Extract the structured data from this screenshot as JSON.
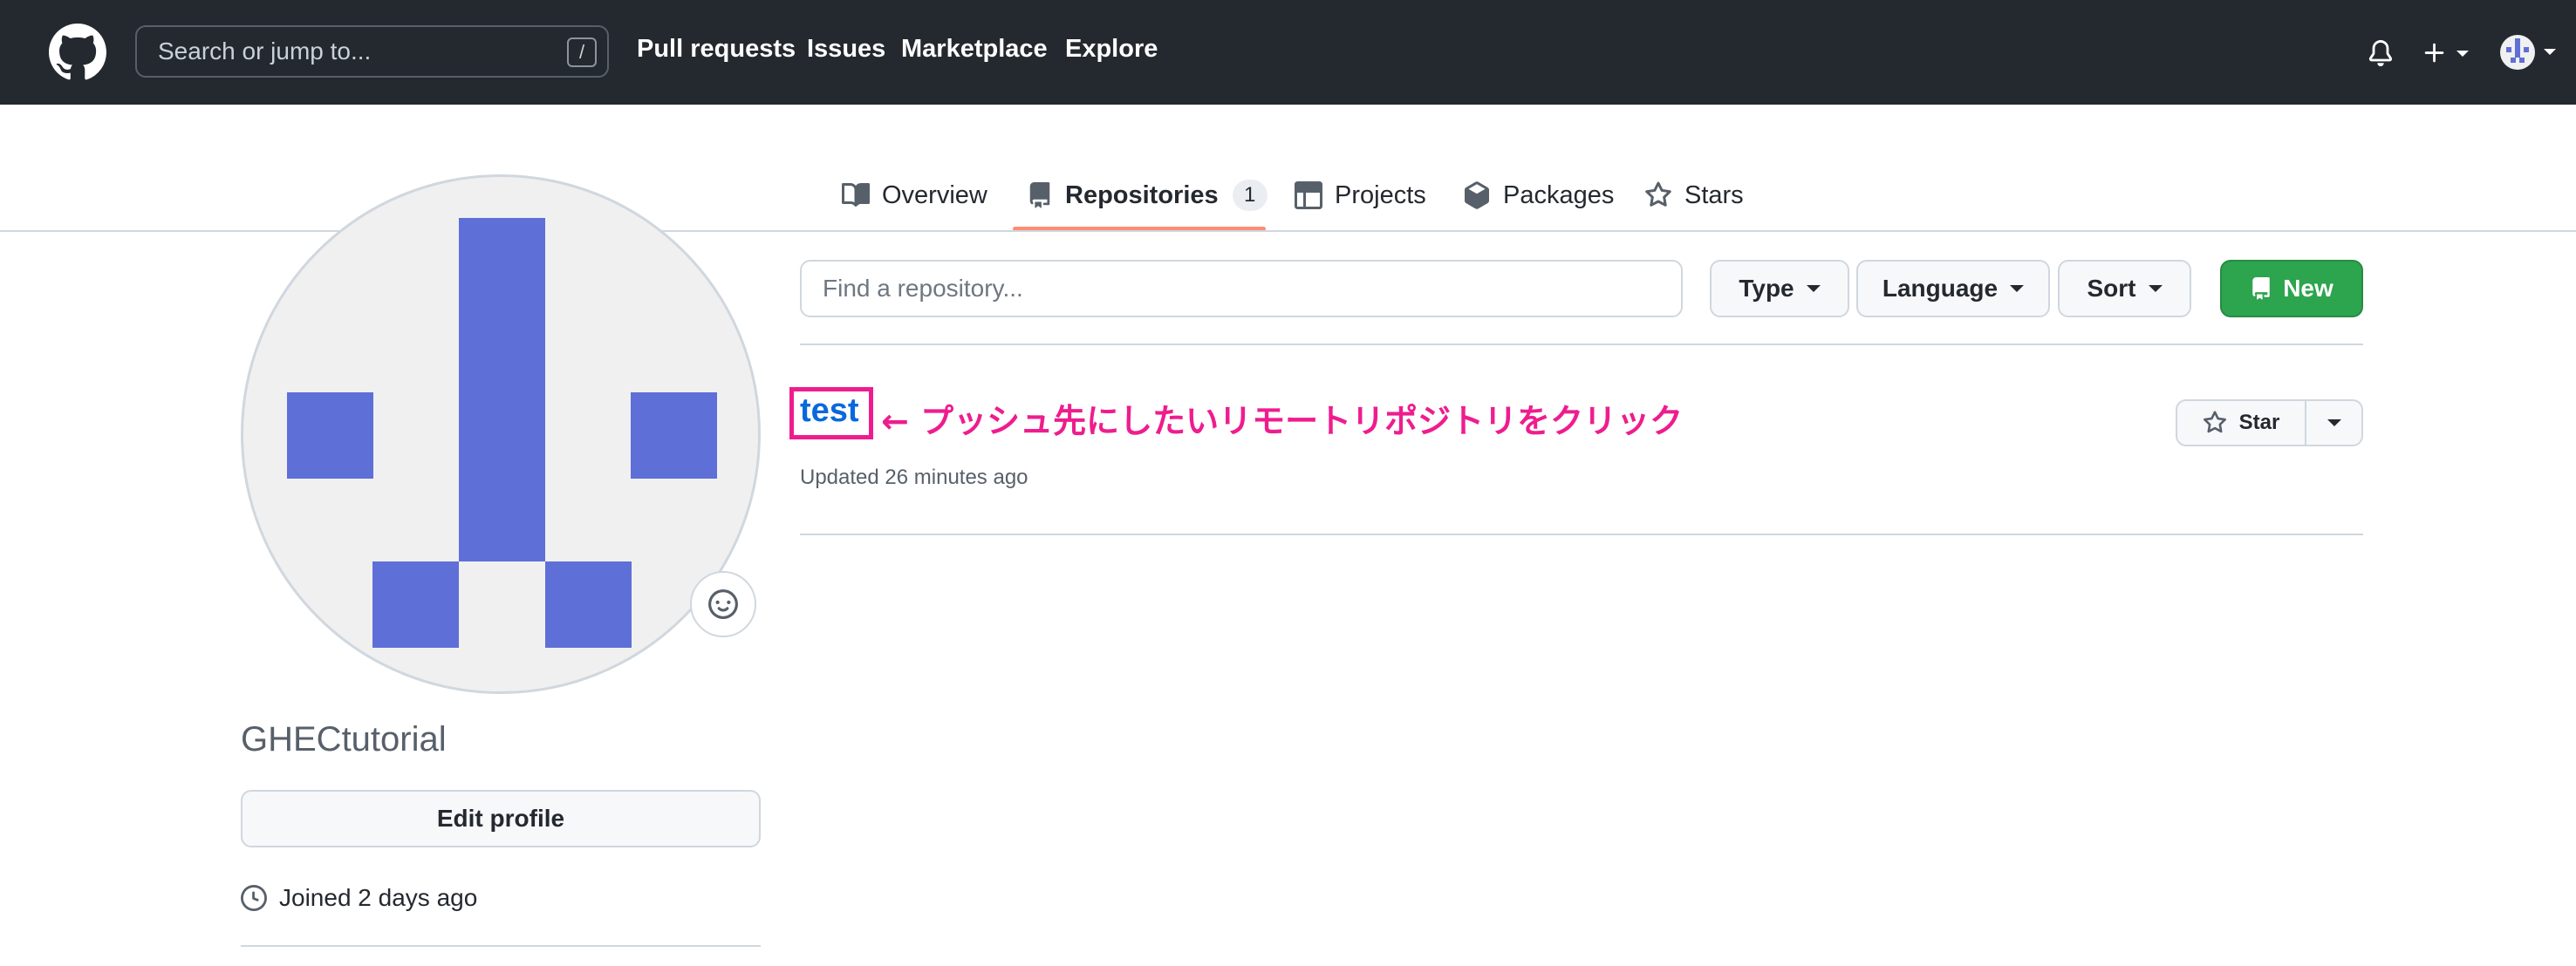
{
  "header": {
    "search_placeholder": "Search or jump to...",
    "search_shortcut": "/",
    "nav": [
      "Pull requests",
      "Issues",
      "Marketplace",
      "Explore"
    ]
  },
  "tabs": [
    {
      "label": "Overview",
      "icon": "book-icon"
    },
    {
      "label": "Repositories",
      "icon": "repo-icon",
      "count": "1",
      "active": true
    },
    {
      "label": "Projects",
      "icon": "table-icon"
    },
    {
      "label": "Packages",
      "icon": "package-icon"
    },
    {
      "label": "Stars",
      "icon": "star-icon"
    }
  ],
  "profile": {
    "username": "GHECtutorial",
    "edit_label": "Edit profile",
    "joined": "Joined 2 days ago",
    "avatar_color": "#5f6fd8"
  },
  "repo_controls": {
    "find_placeholder": "Find a repository...",
    "type_label": "Type",
    "language_label": "Language",
    "sort_label": "Sort",
    "new_label": "New"
  },
  "repos": [
    {
      "name": "test",
      "updated": "Updated 26 minutes ago",
      "star_label": "Star"
    }
  ],
  "annotation": {
    "text": "← プッシュ先にしたいリモートリポジトリをクリック",
    "color": "#ee1d8e"
  },
  "colors": {
    "header_bg": "#24292f",
    "accent_green": "#2da44e",
    "link_blue": "#0969da",
    "tab_underline": "#fd8c73"
  }
}
